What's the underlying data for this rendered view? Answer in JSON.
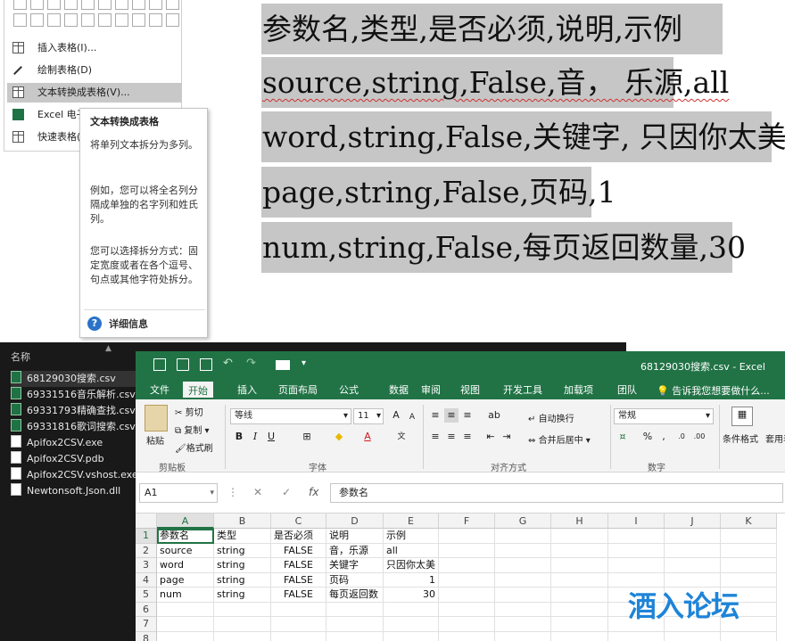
{
  "word_menu": {
    "items": [
      {
        "label": "插入表格(I)...",
        "icon": "insert-table-icon"
      },
      {
        "label": "绘制表格(D)",
        "icon": "draw-table-icon"
      },
      {
        "label": "文本转换成表格(V)...",
        "icon": "convert-text-icon"
      },
      {
        "label": "Excel 电子",
        "icon": "excel-icon"
      },
      {
        "label": "快速表格(",
        "icon": "quick-table-icon"
      }
    ]
  },
  "tooltip": {
    "title": "文本转换成表格",
    "p1": "将单列文本拆分为多列。",
    "p2": "例如，您可以将全名列分隔成单独的名字列和姓氏列。",
    "p3": "您可以选择拆分方式：固定宽度或者在各个逗号、句点或其他字符处拆分。",
    "help_icon": "?",
    "help_label": "详细信息"
  },
  "document": {
    "lines": [
      [
        "参数名,类型,是否必须,说明,示例"
      ],
      [
        "source,string,False,音， 乐源,all"
      ],
      [
        "word,string,False,关键字, 只因你太美"
      ],
      [
        "page,string,False,页码,1"
      ],
      [
        "num,string,False,每页返回数量,30"
      ]
    ]
  },
  "explorer": {
    "header": "名称",
    "files": [
      "68129030搜索.csv",
      "69331516音乐解析.csv",
      "69331793精确查找.csv",
      "69331816歌词搜索.csv",
      "Apifox2CSV.exe",
      "Apifox2CSV.pdb",
      "Apifox2CSV.vshost.exe",
      "Newtonsoft.Json.dll"
    ]
  },
  "excel": {
    "title": "68129030搜索.csv - Excel",
    "tabs": [
      "文件",
      "开始",
      "插入",
      "页面布局",
      "公式",
      "数据",
      "审阅",
      "视图",
      "开发工具",
      "加载项",
      "团队"
    ],
    "tell_me": "告诉我您想要做什么...",
    "ribbon": {
      "paste": "粘贴",
      "cut": "剪切",
      "copy": "复制",
      "format_painter": "格式刷",
      "clipboard": "剪贴板",
      "font_name": "等线",
      "font_size": "11",
      "font_group": "字体",
      "wrap": "自动换行",
      "merge": "合并后居中",
      "align_group": "对齐方式",
      "number_format": "常规",
      "number_group": "数字",
      "conditional": "条件格式",
      "table_fmt": "套用表格",
      "bold": "B",
      "italic": "I",
      "underline": "U",
      "percent": "%",
      "comma": ","
    },
    "namebox": "A1",
    "formula": "参数名",
    "columns": [
      "A",
      "B",
      "C",
      "D",
      "E",
      "F",
      "G",
      "H",
      "I",
      "J",
      "K"
    ],
    "rows": [
      "1",
      "2",
      "3",
      "4",
      "5",
      "6",
      "7",
      "8"
    ],
    "cells": [
      [
        "参数名",
        "类型",
        "是否必须",
        "说明",
        "示例"
      ],
      [
        "source",
        "string",
        "FALSE",
        "音，乐源",
        "all"
      ],
      [
        "word",
        "string",
        "FALSE",
        "关键字",
        "只因你太美"
      ],
      [
        "page",
        "string",
        "FALSE",
        "页码",
        "1"
      ],
      [
        "num",
        "string",
        "FALSE",
        "每页返回数",
        "30"
      ]
    ]
  },
  "watermark": "酒入论坛",
  "colors": {
    "excel_green": "#217346",
    "selection_gray": "#c6c6c6",
    "watermark_blue": "#1e84d8"
  }
}
